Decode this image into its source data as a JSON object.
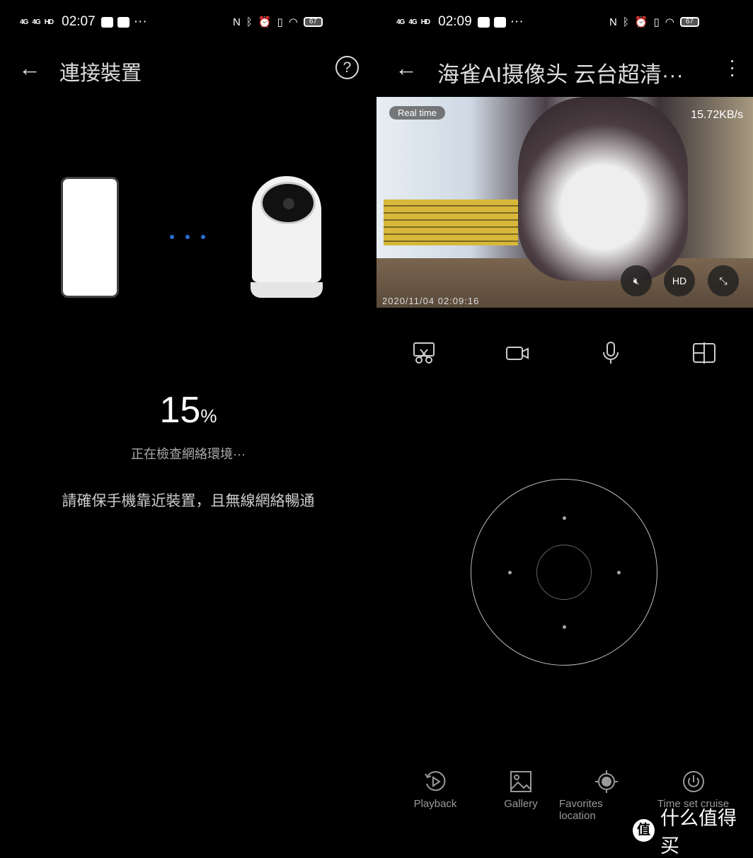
{
  "left": {
    "status": {
      "net1": "4G",
      "net2": "4G",
      "hd": "HD",
      "time": "02:07",
      "more": "···",
      "battery": "67"
    },
    "title": "連接裝置",
    "help": "?",
    "progress_percent": 15,
    "progress_value": "15",
    "progress_unit": "%",
    "checking": "正在檢查網絡環境···",
    "hint": "請確保手機靠近裝置，且無線網絡暢通"
  },
  "right": {
    "status": {
      "net1": "4G",
      "net2": "4G",
      "hd": "HD",
      "time": "02:09",
      "more": "···",
      "battery": "67"
    },
    "title": "海雀AI摄像头 云台超清···",
    "video": {
      "mode": "Real time",
      "rate": "15.72KB/s",
      "timestamp": "2020/11/04  02:09:16",
      "hd": "HD"
    },
    "nav": [
      {
        "label": "Playback",
        "icon": "playback-icon"
      },
      {
        "label": "Gallery",
        "icon": "gallery-icon"
      },
      {
        "label": "Favorites location",
        "icon": "location-target-icon"
      },
      {
        "label": "Time set cruise",
        "icon": "timer-icon"
      }
    ],
    "watermark": {
      "badge": "值",
      "text": "什么值得买"
    }
  }
}
